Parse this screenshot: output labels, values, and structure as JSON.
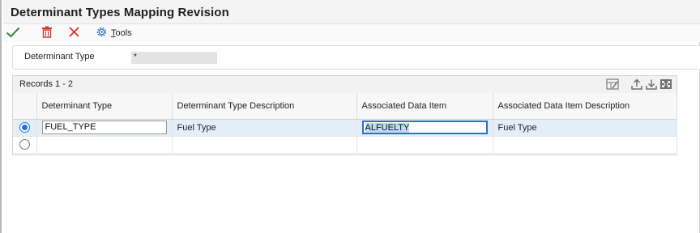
{
  "window": {
    "title": "Determinant Types Mapping Revision"
  },
  "toolbar": {
    "ok_icon": "checkmark-icon",
    "delete_icon": "trash-icon",
    "cancel_icon": "close-icon",
    "tools_icon": "gear-icon",
    "tools_label": "Tools",
    "tools_accesskey_letter": "T",
    "tools_rest": "ools"
  },
  "header": {
    "determinant_type_label": "Determinant Type",
    "determinant_type_value": "*"
  },
  "grid": {
    "records_label": "Records 1 - 2",
    "icons": [
      "customize-grid-icon",
      "export-icon",
      "import-icon",
      "maximize-grid-icon"
    ],
    "columns": [
      "",
      "Determinant Type",
      "Determinant Type Description",
      "Associated Data Item",
      "Associated Data Item Description"
    ],
    "rows": [
      {
        "selected": true,
        "determinant_type": "FUEL_TYPE",
        "determinant_type_description": "Fuel Type",
        "associated_data_item": "ALFUELTY",
        "associated_data_item_description": "Fuel Type"
      },
      {
        "selected": false,
        "determinant_type": "",
        "determinant_type_description": "",
        "associated_data_item": "",
        "associated_data_item_description": ""
      }
    ]
  },
  "colors": {
    "accent": "#1a73e8",
    "ok_green": "#2e8b3a",
    "delete_red": "#d9342b",
    "selected_row": "#e4eef9"
  }
}
